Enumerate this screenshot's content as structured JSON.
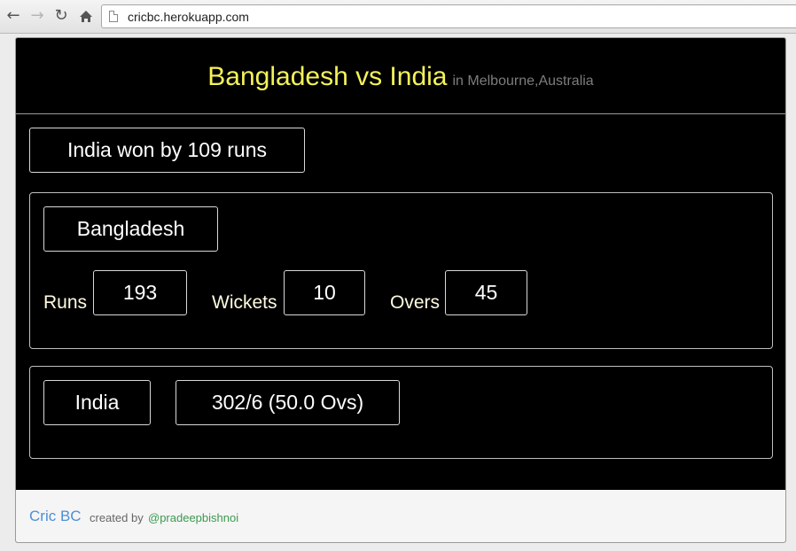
{
  "browser": {
    "url": "cricbc.herokuapp.com"
  },
  "header": {
    "title": "Bangladesh vs India",
    "venue": "in Melbourne,Australia"
  },
  "result": "India won by 109 runs",
  "team1": {
    "name": "Bangladesh",
    "runs_label": "Runs",
    "runs": "193",
    "wickets_label": "Wickets",
    "wickets": "10",
    "overs_label": "Overs",
    "overs": "45"
  },
  "team2": {
    "name": "India",
    "score": "302/6 (50.0 Ovs)"
  },
  "footer": {
    "brand": "Cric BC",
    "created_by": "created by",
    "author": "@pradeepbishnoi"
  },
  "colors": {
    "title": "#f4f25a",
    "brand": "#4d8fd6",
    "author": "#3a9a4f"
  }
}
